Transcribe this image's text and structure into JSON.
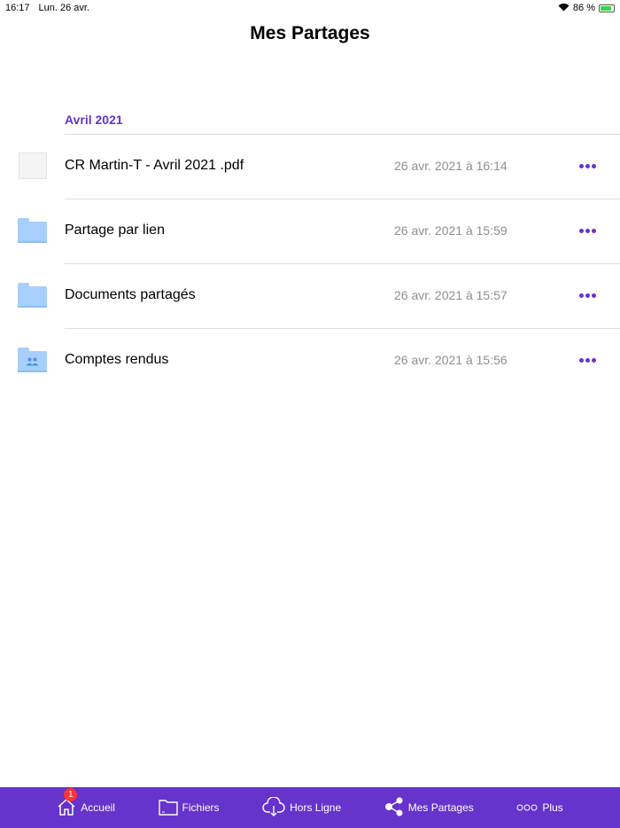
{
  "status": {
    "time": "16:17",
    "date": "Lun. 26 avr.",
    "battery": "86 %",
    "battery_level": 86
  },
  "title": "Mes Partages",
  "section": "Avril 2021",
  "items": [
    {
      "name": "CR Martin-T - Avril 2021 .pdf",
      "date": "26 avr. 2021 à 16:14",
      "icon": "pdf-thumbnail-icon"
    },
    {
      "name": "Partage par lien",
      "date": "26 avr. 2021 à 15:59",
      "icon": "folder-icon"
    },
    {
      "name": "Documents partagés",
      "date": "26 avr. 2021 à 15:57",
      "icon": "folder-icon"
    },
    {
      "name": "Comptes rendus",
      "date": "26 avr. 2021 à 15:56",
      "icon": "shared-folder-icon"
    }
  ],
  "tabs": [
    {
      "label": "Accueil",
      "badge": "1"
    },
    {
      "label": "Fichiers"
    },
    {
      "label": "Hors Ligne"
    },
    {
      "label": "Mes Partages"
    },
    {
      "label": "Plus"
    }
  ],
  "colors": {
    "accent": "#6633cc",
    "folder": "#a7cffb"
  }
}
